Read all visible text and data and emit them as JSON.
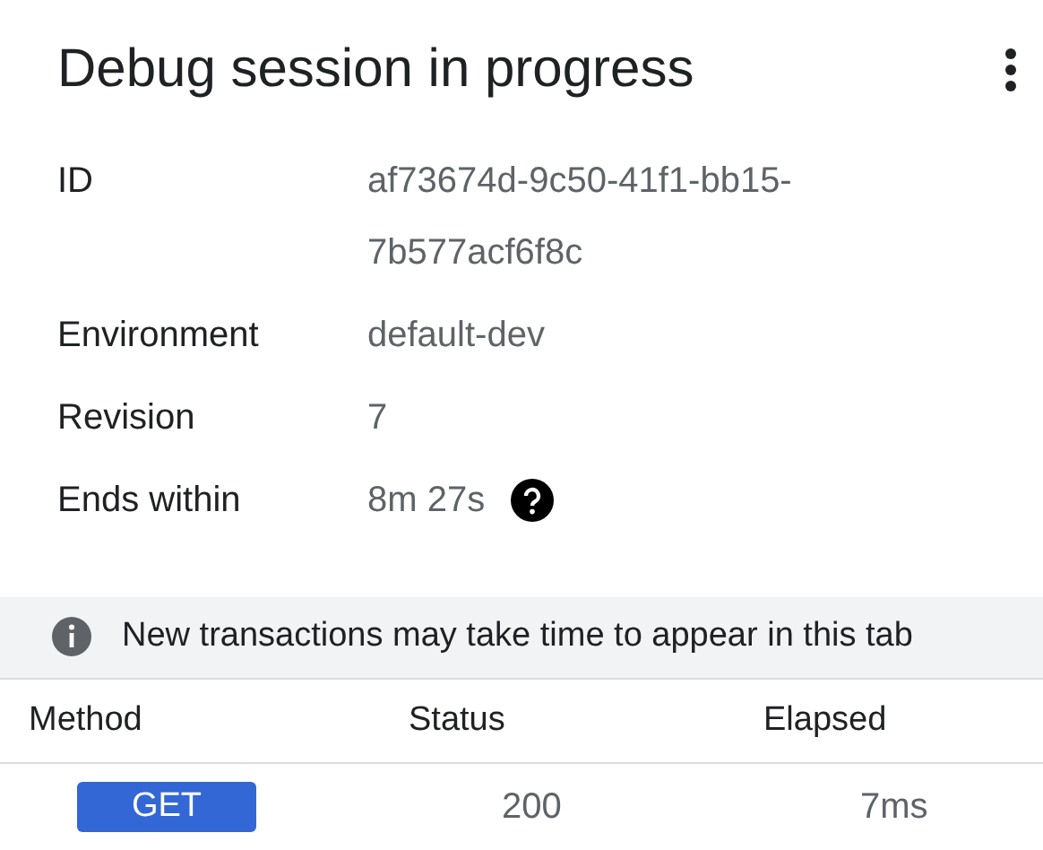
{
  "header": {
    "title": "Debug session in progress"
  },
  "details": [
    {
      "label": "ID",
      "value": "af73674d-9c50-41f1-bb15-7b577acf6f8c"
    },
    {
      "label": "Environment",
      "value": "default-dev"
    },
    {
      "label": "Revision",
      "value": "7"
    },
    {
      "label": "Ends within",
      "value": "8m 27s",
      "help": true
    }
  ],
  "banner": {
    "text": "New transactions may take time to appear in this tab"
  },
  "table": {
    "columns": [
      "Method",
      "Status",
      "Elapsed"
    ],
    "rows": [
      {
        "method": "GET",
        "status": "200",
        "elapsed": "7ms"
      }
    ]
  }
}
